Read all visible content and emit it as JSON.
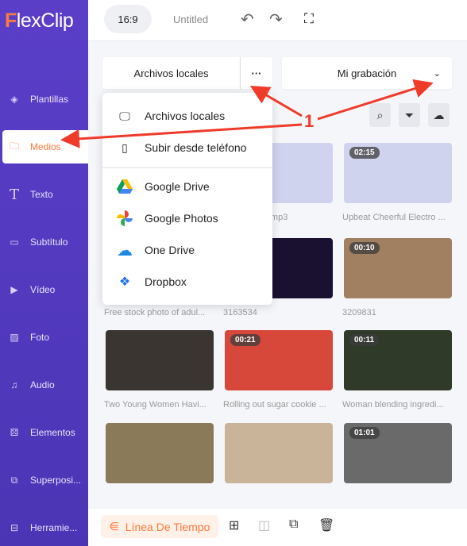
{
  "app": {
    "logo": "FlexClip"
  },
  "sidebar": {
    "items": [
      {
        "label": "Plantillas",
        "icon": "layers-icon"
      },
      {
        "label": "Medios",
        "icon": "folder-plus-icon",
        "active": true
      },
      {
        "label": "Texto",
        "icon": "text-icon"
      },
      {
        "label": "Subtítulo",
        "icon": "subtitle-icon"
      },
      {
        "label": "Vídeo",
        "icon": "video-icon"
      },
      {
        "label": "Foto",
        "icon": "image-icon"
      },
      {
        "label": "Audio",
        "icon": "music-icon"
      },
      {
        "label": "Elementos",
        "icon": "shapes-icon"
      },
      {
        "label": "Superposi...",
        "icon": "overlay-icon"
      },
      {
        "label": "Herramie...",
        "icon": "toolbox-icon"
      }
    ]
  },
  "header": {
    "ratio": "16:9",
    "title": "Untitled"
  },
  "toolbar": {
    "source": "Archivos locales",
    "more": "···",
    "folder": "Mi grabación"
  },
  "menu": {
    "items": [
      "Archivos locales",
      "Subir desde teléfono",
      "Google Drive",
      "Google Photos",
      "One Drive",
      "Dropbox"
    ]
  },
  "media": [
    {
      "caption": "",
      "duration": ""
    },
    {
      "caption": "...enveni...9.mp3",
      "duration": ""
    },
    {
      "caption": "Upbeat Cheerful Electro ...",
      "duration": "02:15"
    },
    {
      "caption": "Free stock photo of adul...",
      "duration": ""
    },
    {
      "caption": "3163534",
      "duration": ""
    },
    {
      "caption": "3209831",
      "duration": "00:10"
    },
    {
      "caption": "Two Young Women Havi...",
      "duration": ""
    },
    {
      "caption": "Rolling out sugar cookie ...",
      "duration": "00:21"
    },
    {
      "caption": "Woman blending ingredi...",
      "duration": "00:11"
    },
    {
      "caption": "",
      "duration": ""
    },
    {
      "caption": "",
      "duration": ""
    },
    {
      "caption": "",
      "duration": "01:01"
    }
  ],
  "annotation": {
    "label": "1",
    "color": "#f03a2a"
  },
  "bottom": {
    "timeline": "Línea De Tiempo"
  },
  "colors": {
    "accent": "#ff7a3d",
    "sidebar": "#5a3ec8"
  }
}
